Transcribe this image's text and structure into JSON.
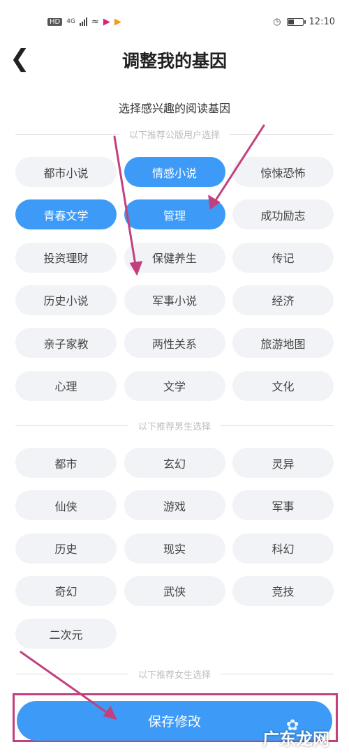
{
  "status": {
    "hd": "HD",
    "network": "4G",
    "time": "12:10"
  },
  "header": {
    "title": "调整我的基因"
  },
  "subtitle": "选择感兴趣的阅读基因",
  "sections": [
    {
      "heading": "以下推荐公版用户选择",
      "tags": [
        {
          "label": "都市小说",
          "selected": false
        },
        {
          "label": "情感小说",
          "selected": true
        },
        {
          "label": "惊悚恐怖",
          "selected": false
        },
        {
          "label": "青春文学",
          "selected": true
        },
        {
          "label": "管理",
          "selected": true
        },
        {
          "label": "成功励志",
          "selected": false
        },
        {
          "label": "投资理财",
          "selected": false
        },
        {
          "label": "保健养生",
          "selected": false
        },
        {
          "label": "传记",
          "selected": false
        },
        {
          "label": "历史小说",
          "selected": false
        },
        {
          "label": "军事小说",
          "selected": false
        },
        {
          "label": "经济",
          "selected": false
        },
        {
          "label": "亲子家教",
          "selected": false
        },
        {
          "label": "两性关系",
          "selected": false
        },
        {
          "label": "旅游地图",
          "selected": false
        },
        {
          "label": "心理",
          "selected": false
        },
        {
          "label": "文学",
          "selected": false
        },
        {
          "label": "文化",
          "selected": false
        }
      ]
    },
    {
      "heading": "以下推荐男生选择",
      "tags": [
        {
          "label": "都市",
          "selected": false
        },
        {
          "label": "玄幻",
          "selected": false
        },
        {
          "label": "灵异",
          "selected": false
        },
        {
          "label": "仙侠",
          "selected": false
        },
        {
          "label": "游戏",
          "selected": false
        },
        {
          "label": "军事",
          "selected": false
        },
        {
          "label": "历史",
          "selected": false
        },
        {
          "label": "现实",
          "selected": false
        },
        {
          "label": "科幻",
          "selected": false
        },
        {
          "label": "奇幻",
          "selected": false
        },
        {
          "label": "武侠",
          "selected": false
        },
        {
          "label": "竞技",
          "selected": false
        },
        {
          "label": "二次元",
          "selected": false
        }
      ]
    },
    {
      "heading": "以下推荐女生选择",
      "tags": []
    }
  ],
  "save_button": "保存修改",
  "watermark": "广东龙网",
  "colors": {
    "accent": "#3d9bf7",
    "annotation": "#c2407d"
  }
}
